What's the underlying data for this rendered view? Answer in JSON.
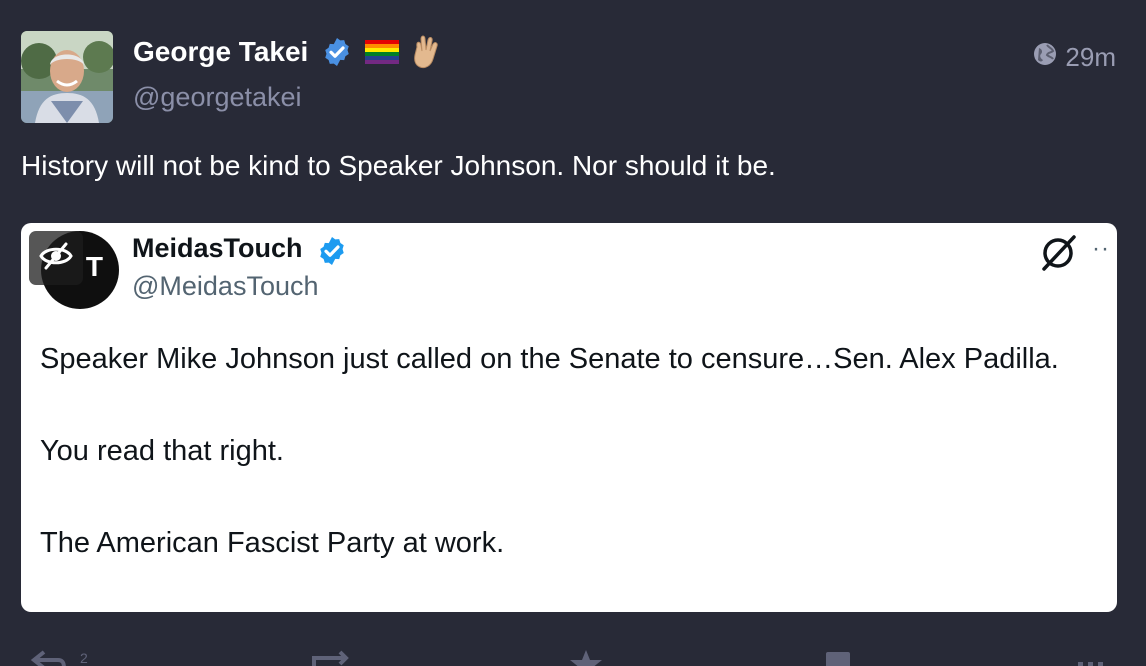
{
  "author": {
    "display_name": "George Takei",
    "handle": "@georgetakei",
    "name_emojis": [
      "rainbow-flag",
      "vulcan-salute"
    ]
  },
  "timestamp": {
    "visibility_icon": "globe-icon",
    "text": "29m"
  },
  "post": {
    "text": "History will not be kind to Speaker Johnson. Nor should it be."
  },
  "embed": {
    "display_name": "MeidasTouch",
    "handle": "@MeidasTouch",
    "avatar_letter": "T",
    "paragraphs": [
      "Speaker Mike Johnson just called on the Senate to censure…Sen. Alex Padilla.",
      "You read that right.",
      "The American Fascist Party at work."
    ]
  },
  "actions": {
    "reply_count": "2"
  },
  "colors": {
    "background": "#282a37",
    "verified": "#4a90e2",
    "embed_verified": "#1d9bf0",
    "muted_text": "#8b8fa8"
  }
}
